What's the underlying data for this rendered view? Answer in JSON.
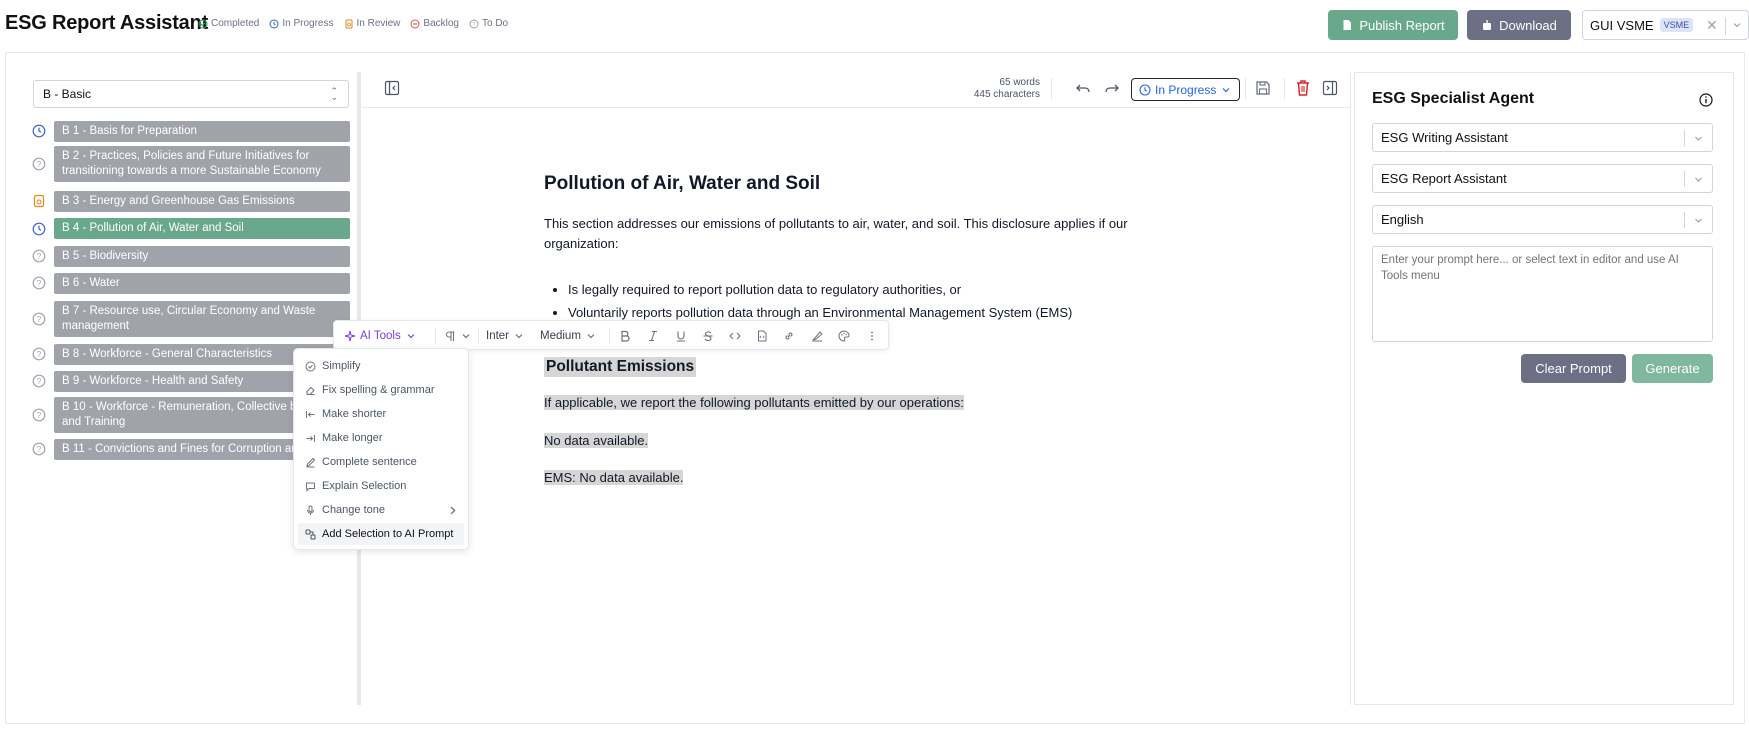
{
  "header": {
    "title": "ESG Report Assistant",
    "legend": [
      {
        "label": "Completed",
        "icon": "check-circle-icon",
        "color": "#22a55b"
      },
      {
        "label": "In Progress",
        "icon": "clock-icon",
        "color": "#3b62d6"
      },
      {
        "label": "In Review",
        "icon": "review-icon",
        "color": "#e68a1a"
      },
      {
        "label": "Backlog",
        "icon": "backlog-icon",
        "color": "#d9534f"
      },
      {
        "label": "To Do",
        "icon": "question-circle-icon",
        "color": "#9ca3af"
      }
    ],
    "publish_label": "Publish Report",
    "download_label": "Download",
    "org_name": "GUI VSME",
    "org_badge": "VSME"
  },
  "sidebar": {
    "section_select": "B - Basic",
    "items": [
      {
        "label": "B 1 - Basis for Preparation",
        "status": "in-progress"
      },
      {
        "label": "B 2 - Practices, Policies and Future Initiatives for transitioning towards a more Sustainable Economy",
        "status": "to-do"
      },
      {
        "label": "B 3 - Energy and Greenhouse Gas Emissions",
        "status": "in-review"
      },
      {
        "label": "B 4 - Pollution of Air, Water and Soil",
        "status": "in-progress",
        "active": true
      },
      {
        "label": "B 5 - Biodiversity",
        "status": "to-do"
      },
      {
        "label": "B 6 - Water",
        "status": "to-do"
      },
      {
        "label": "B 7 - Resource use, Circular Economy and Waste management",
        "status": "to-do"
      },
      {
        "label": "B 8 - Workforce - General Characteristics",
        "status": "to-do"
      },
      {
        "label": "B 9 - Workforce - Health and Safety",
        "status": "to-do"
      },
      {
        "label": "B 10 - Workforce - Remuneration, Collective ba",
        "label_line2": "and Training",
        "status": "to-do"
      },
      {
        "label": "B 11 - Convictions and Fines for Corruption and",
        "status": "to-do"
      }
    ]
  },
  "editor": {
    "word_count": "65 words",
    "char_count": "445 characters",
    "status": "In Progress",
    "doc": {
      "heading": "Pollution of Air, Water and Soil",
      "intro": "This section addresses our emissions of pollutants to air, water, and soil. This disclosure applies if our organization:",
      "bullets": [
        "Is legally required to report pollution data to regulatory authorities, or",
        "Voluntarily reports pollution data through an Environmental Management System (EMS)"
      ],
      "subheading": "Pollutant Emissions",
      "p1": "If applicable, we report the following pollutants emitted by our operations:",
      "p2": "No data available.",
      "p3": "EMS: No data available."
    },
    "format_toolbar": {
      "ai_tools": "AI Tools",
      "font": "Inter",
      "weight": "Medium"
    },
    "ai_menu": [
      {
        "label": "Simplify",
        "icon": "circle-check-icon"
      },
      {
        "label": "Fix spelling & grammar",
        "icon": "eraser-icon"
      },
      {
        "label": "Make shorter",
        "icon": "arrow-left-to-line-icon"
      },
      {
        "label": "Make longer",
        "icon": "arrow-right-to-line-icon"
      },
      {
        "label": "Complete sentence",
        "icon": "pen-icon"
      },
      {
        "label": "Explain Selection",
        "icon": "message-icon"
      },
      {
        "label": "Change tone",
        "icon": "mic-icon"
      },
      {
        "label": "Add Selection to AI Prompt",
        "icon": "add-to-prompt-icon"
      }
    ]
  },
  "agent": {
    "title": "ESG Specialist Agent",
    "selects": [
      "ESG Writing Assistant",
      "ESG Report Assistant",
      "English"
    ],
    "prompt_placeholder": "Enter your prompt here... or select text in editor and use AI Tools menu",
    "clear_label": "Clear Prompt",
    "generate_label": "Generate"
  },
  "colors": {
    "accent_green": "#6aa88c",
    "slate_button": "#6b7084",
    "pill_gray": "#a1a3ab",
    "ai_purple": "#7c3aed"
  }
}
